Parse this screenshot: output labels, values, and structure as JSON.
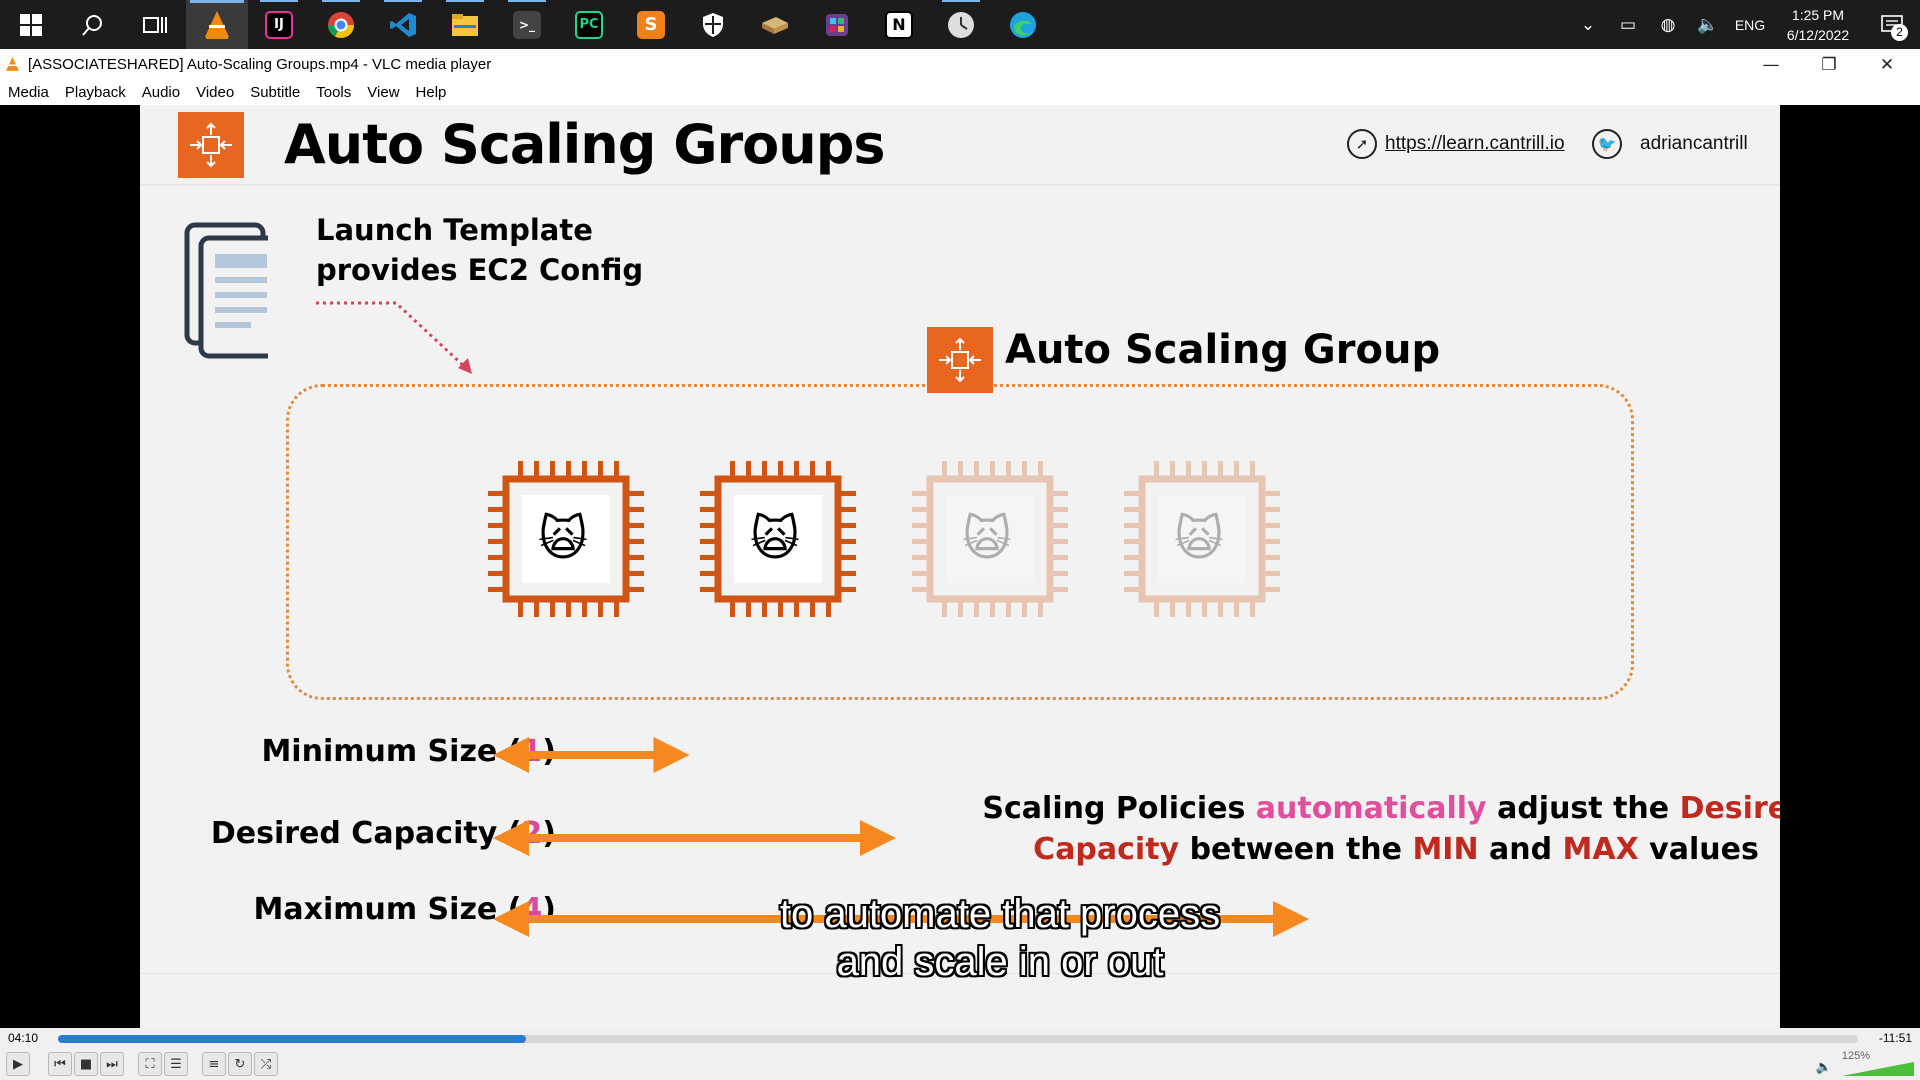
{
  "taskbar": {
    "apps": [
      {
        "icon": "windows-start-icon",
        "color": "#ffffff"
      },
      {
        "icon": "search-icon",
        "color": "#ffffff"
      },
      {
        "icon": "task-view-icon",
        "color": "#ffffff"
      },
      {
        "icon": "vlc-icon",
        "color": "#f08a12",
        "active": true
      },
      {
        "icon": "intellij-icon",
        "color": "#2b2d7a"
      },
      {
        "icon": "chrome-icon",
        "color": "#db4437"
      },
      {
        "icon": "vscode-icon",
        "color": "#1f8ad2"
      },
      {
        "icon": "file-explorer-icon",
        "color": "#f5c542"
      },
      {
        "icon": "terminal-icon",
        "color": "#444444"
      },
      {
        "icon": "pycharm-icon",
        "color": "#21d789"
      },
      {
        "icon": "sublime-icon",
        "color": "#f0811a"
      },
      {
        "icon": "security-icon",
        "color": "#ffffff"
      },
      {
        "icon": "app-icon",
        "color": "#c9a060"
      },
      {
        "icon": "slack-icon",
        "color": "#7b4f9e"
      },
      {
        "icon": "notion-icon",
        "color": "#ffffff"
      },
      {
        "icon": "clock-app-icon",
        "color": "#dddddd"
      },
      {
        "icon": "edge-icon",
        "color": "#1fa3e0"
      }
    ],
    "tray": {
      "language": "ENG",
      "time": "1:25 PM",
      "date": "6/12/2022",
      "notifications": "2"
    }
  },
  "window": {
    "title": "[ASSOCIATESHARED] Auto-Scaling Groups.mp4 - VLC media player",
    "controls": {
      "minimize": "—",
      "maximize": "❐",
      "close": "✕"
    }
  },
  "menu": [
    "Media",
    "Playback",
    "Audio",
    "Video",
    "Subtitle",
    "Tools",
    "View",
    "Help"
  ],
  "slide": {
    "title": "Auto Scaling Groups",
    "url": "https://learn.cantrill.io",
    "twitter": "adriancantrill",
    "launch_template_line1": "Launch Template",
    "launch_template_line2": "provides EC2 Config",
    "asg_label": "Auto Scaling Group",
    "instances": [
      {
        "state": "active"
      },
      {
        "state": "active"
      },
      {
        "state": "faded"
      },
      {
        "state": "faded"
      }
    ],
    "instance_face": "🙀",
    "min": {
      "label": "Minimum Size (",
      "num": "1",
      "end": ")",
      "arrow_value": 1
    },
    "desired": {
      "label": "Desired Capacity (",
      "num": "2",
      "end": ")",
      "arrow_value": 2
    },
    "max": {
      "label": "Maximum Size (",
      "num": "4",
      "end": ")",
      "arrow_value": 4
    },
    "policy": {
      "p1": "Scaling Policies ",
      "p2": "automatically",
      "p3": " adjust the ",
      "p4": "Desired",
      "p5": "Capacity",
      "p6": " between the ",
      "p7": "MIN",
      "p8": " and ",
      "p9": "MAX",
      "p10": " values"
    },
    "colors": {
      "orange": "#e8661f",
      "arrow": "#f5891f",
      "pink": "#e04e9c",
      "red": "#c02a1e"
    }
  },
  "subtitle": {
    "line1": "to automate that process",
    "line2": "and scale in or out"
  },
  "player": {
    "elapsed": "04:10",
    "remaining": "-11:51",
    "progress": 0.26,
    "volume": "125%",
    "volume_level": 1.25
  }
}
